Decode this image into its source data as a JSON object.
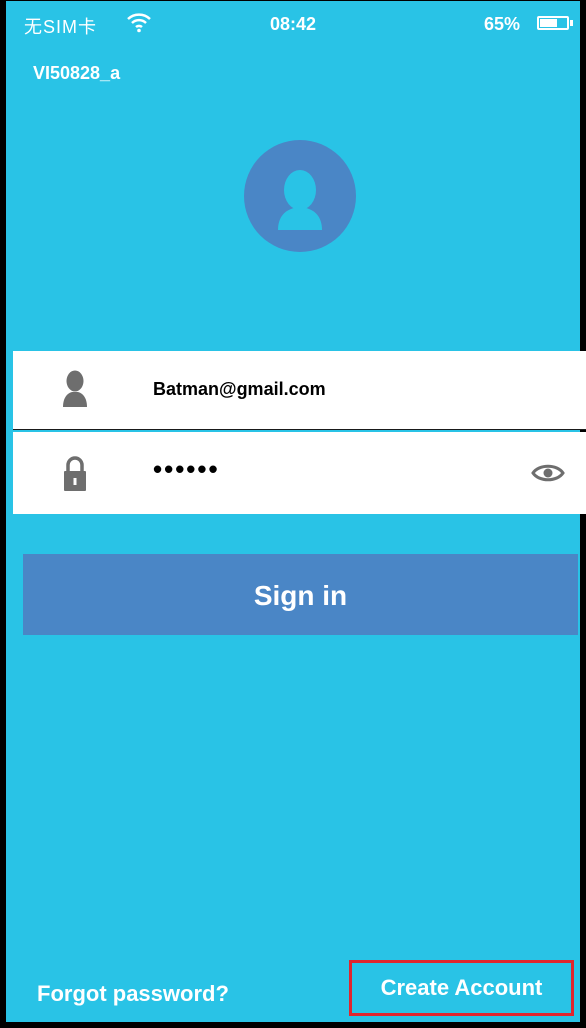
{
  "status_bar": {
    "carrier": "无SIM卡",
    "time": "08:42",
    "battery_percent": "65%",
    "battery_level": 0.65,
    "wifi_icon": "wifi-icon"
  },
  "device_name": "VI50828_a",
  "colors": {
    "background": "#29c3e6",
    "accent": "#4a86c6",
    "highlight_border": "#e0262e"
  },
  "login": {
    "username_value": "Batman@gmail.com",
    "password_value": "••••••",
    "username_icon": "user-icon",
    "password_icon": "lock-icon",
    "toggle_icon": "eye-icon",
    "signin_label": "Sign in"
  },
  "footer": {
    "forgot_label": "Forgot password?",
    "create_label": "Create Account"
  }
}
